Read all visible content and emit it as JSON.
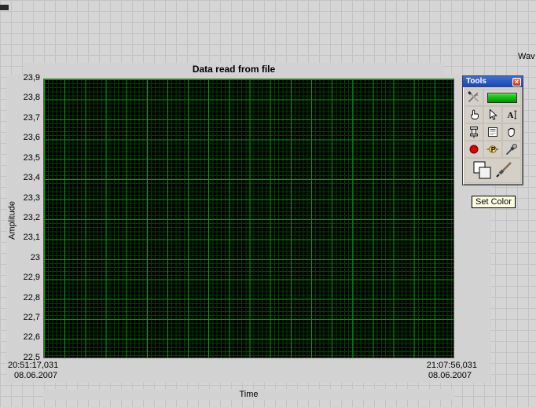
{
  "window": {
    "partial_label": "Wav"
  },
  "chart": {
    "title": "Data read from file",
    "x_axis": {
      "label": "Time",
      "start_time": "20:51:17,031",
      "start_date": "08.06.2007",
      "end_time": "21:07:56,031",
      "end_date": "08.06.2007"
    },
    "y_axis": {
      "label": "Amplitude",
      "min": "22,5",
      "max": "23,9",
      "ticks": [
        "23,9",
        "23,8",
        "23,7",
        "23,6",
        "23,5",
        "23,4",
        "23,3",
        "23,2",
        "23,1",
        "23",
        "22,9",
        "22,8",
        "22,7",
        "22,6",
        "22,5"
      ]
    },
    "colors": {
      "plot_background": "#000000",
      "grid_major": "#00a800",
      "grid_minor": "#004000",
      "panel_gray": "#d2d2d2"
    },
    "plotted_series": []
  },
  "tools_palette": {
    "title": "Tools",
    "close_glyph": "×",
    "edit_text_glyph": "A",
    "probe_glyph": "P",
    "tooltip": "Set Color",
    "colors": {
      "titlebar_blue": "#2a56c0",
      "led_green": "#00c000",
      "breakpoint_red": "#dd0000",
      "tooltip_yellow": "#ffffe1"
    },
    "tools": [
      {
        "id": "automatic-tool-selection",
        "icon": "wrench-screwdriver-icon"
      },
      {
        "id": "auto-tool-led",
        "icon": "green-led-icon"
      },
      {
        "id": "operate-value",
        "icon": "pointing-hand-icon"
      },
      {
        "id": "position-select",
        "icon": "arrow-cursor-icon"
      },
      {
        "id": "edit-text",
        "icon": "text-edit-icon"
      },
      {
        "id": "connect-wire",
        "icon": "wire-spool-icon"
      },
      {
        "id": "object-shortcut-menu",
        "icon": "menu-icon"
      },
      {
        "id": "scroll-window",
        "icon": "hand-icon"
      },
      {
        "id": "set-clear-breakpoint",
        "icon": "red-circle-icon"
      },
      {
        "id": "probe-data",
        "icon": "probe-icon"
      },
      {
        "id": "get-color",
        "icon": "eyedropper-icon"
      },
      {
        "id": "set-color",
        "icon": "color-squares-brush-icon"
      }
    ]
  }
}
